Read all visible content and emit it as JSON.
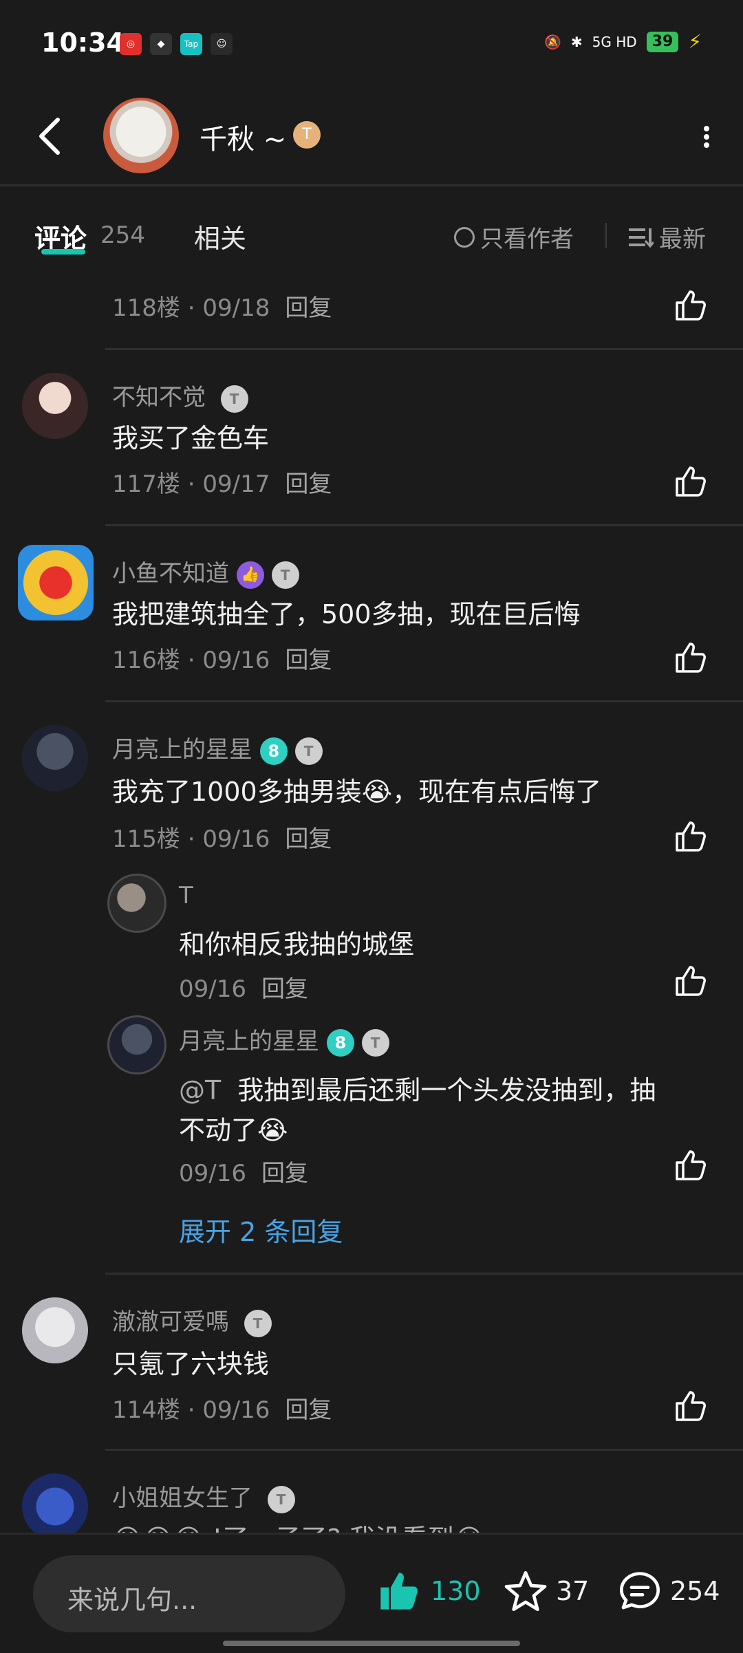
{
  "status_bar": {
    "time": "10:34",
    "battery": "39",
    "network": "5G HD"
  },
  "header": {
    "title": "千秋 ~",
    "badge": "T"
  },
  "tabs": {
    "comments_label": "评论",
    "comments_count": "254",
    "related_label": "相关",
    "only_author": "只看作者",
    "sort": "最新"
  },
  "comments": [
    {
      "meta_floor": "118楼",
      "meta_date": "09/18",
      "reply": "回复"
    },
    {
      "name": "不知不觉",
      "content": "我买了金色车",
      "meta_floor": "117楼",
      "meta_date": "09/17",
      "reply": "回复"
    },
    {
      "name": "小鱼不知道",
      "content": "我把建筑抽全了，500多抽，现在巨后悔",
      "meta_floor": "116楼",
      "meta_date": "09/16",
      "reply": "回复"
    },
    {
      "name": "月亮上的星星",
      "content": "我充了1000多抽男装😭，现在有点后悔了",
      "meta_floor": "115楼",
      "meta_date": "09/16",
      "reply": "回复",
      "replies": [
        {
          "name": "T",
          "content": "和你相反我抽的城堡",
          "date": "09/16",
          "reply": "回复"
        },
        {
          "name": "月亮上的星星",
          "mention": "@T",
          "content_line1": "我抽到最后还剩一个头发没抽到，抽",
          "content_line2": "不动了😭",
          "date": "09/16",
          "reply": "回复"
        }
      ],
      "expand": "展开 2 条回复"
    },
    {
      "name": "澈澈可爱嗎",
      "content": "只氪了六块钱",
      "meta_floor": "114楼",
      "meta_date": "09/16",
      "reply": "回复"
    },
    {
      "name": "小姐姐女生了",
      "content": "😂😂😂 !了，子了? 我没看到😭"
    }
  ],
  "bottom_bar": {
    "input_placeholder": "来说几句...",
    "likes": "130",
    "favorites": "37",
    "comments": "254"
  },
  "colors": {
    "accent": "#19c4b0",
    "link": "#4aa3e6",
    "like_active": "#19c4b0"
  }
}
